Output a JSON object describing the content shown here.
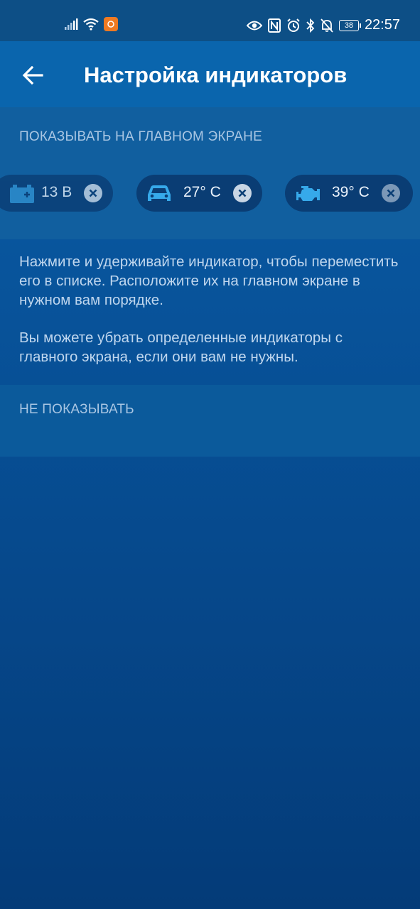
{
  "status_bar": {
    "time": "22:57",
    "battery": "38",
    "left_icons": [
      "signal-icon",
      "wifi-icon",
      "app-notification-icon"
    ],
    "right_icons": [
      "eye-icon",
      "nfc-icon",
      "alarm-icon",
      "bluetooth-icon",
      "notifications-off-icon",
      "battery-icon"
    ]
  },
  "app_bar": {
    "title": "Настройка индикаторов",
    "back_icon": "arrow-left-icon"
  },
  "shown_section": {
    "header": "ПОКАЗЫВАТЬ НА ГЛАВНОМ ЭКРАНЕ",
    "indicators": [
      {
        "icon": "battery-icon",
        "value": "13 В"
      },
      {
        "icon": "car-icon",
        "value": "27° С"
      },
      {
        "icon": "engine-icon",
        "value": "39° С"
      }
    ]
  },
  "info": {
    "paragraph1": "Нажмите и удерживайте индикатор, чтобы переместить его в списке. Расположите их на главном экране в нужном вам порядке.",
    "paragraph2": "Вы можете убрать определенные индикаторы с главного экрана, если они вам не нужны."
  },
  "hidden_section": {
    "header": "НЕ ПОКАЗЫВАТЬ"
  },
  "colors": {
    "accent_icon": "#36a9ea",
    "chip_background": "#0a3d74",
    "remove_button": "#c8d5e4"
  }
}
